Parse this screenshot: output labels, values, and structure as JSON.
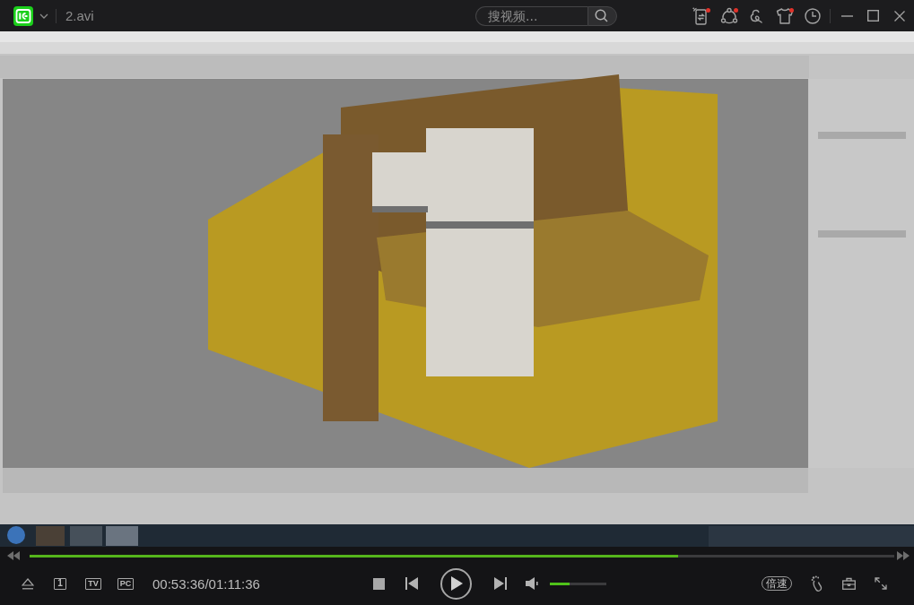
{
  "title_bar": {
    "file_name": "2.avi",
    "search": {
      "placeholder": "搜视频..."
    },
    "tools": [
      {
        "kind": "transfer",
        "badge": true
      },
      {
        "kind": "share",
        "badge": true
      },
      {
        "kind": "skin",
        "badge": false
      },
      {
        "kind": "shirt",
        "badge": true
      },
      {
        "kind": "history",
        "badge": false
      }
    ]
  },
  "player": {
    "progress": {
      "level": 0.75
    },
    "left_buttons": [
      {
        "kind": "eject"
      },
      {
        "kind": "frame",
        "label": "1"
      },
      {
        "kind": "tv",
        "label": "TV"
      },
      {
        "kind": "pc",
        "label": "PC"
      }
    ],
    "time": "00:53:36/01:11:36",
    "playing": false,
    "volume": {
      "level": 0.35
    },
    "speed_button": "倍速"
  }
}
